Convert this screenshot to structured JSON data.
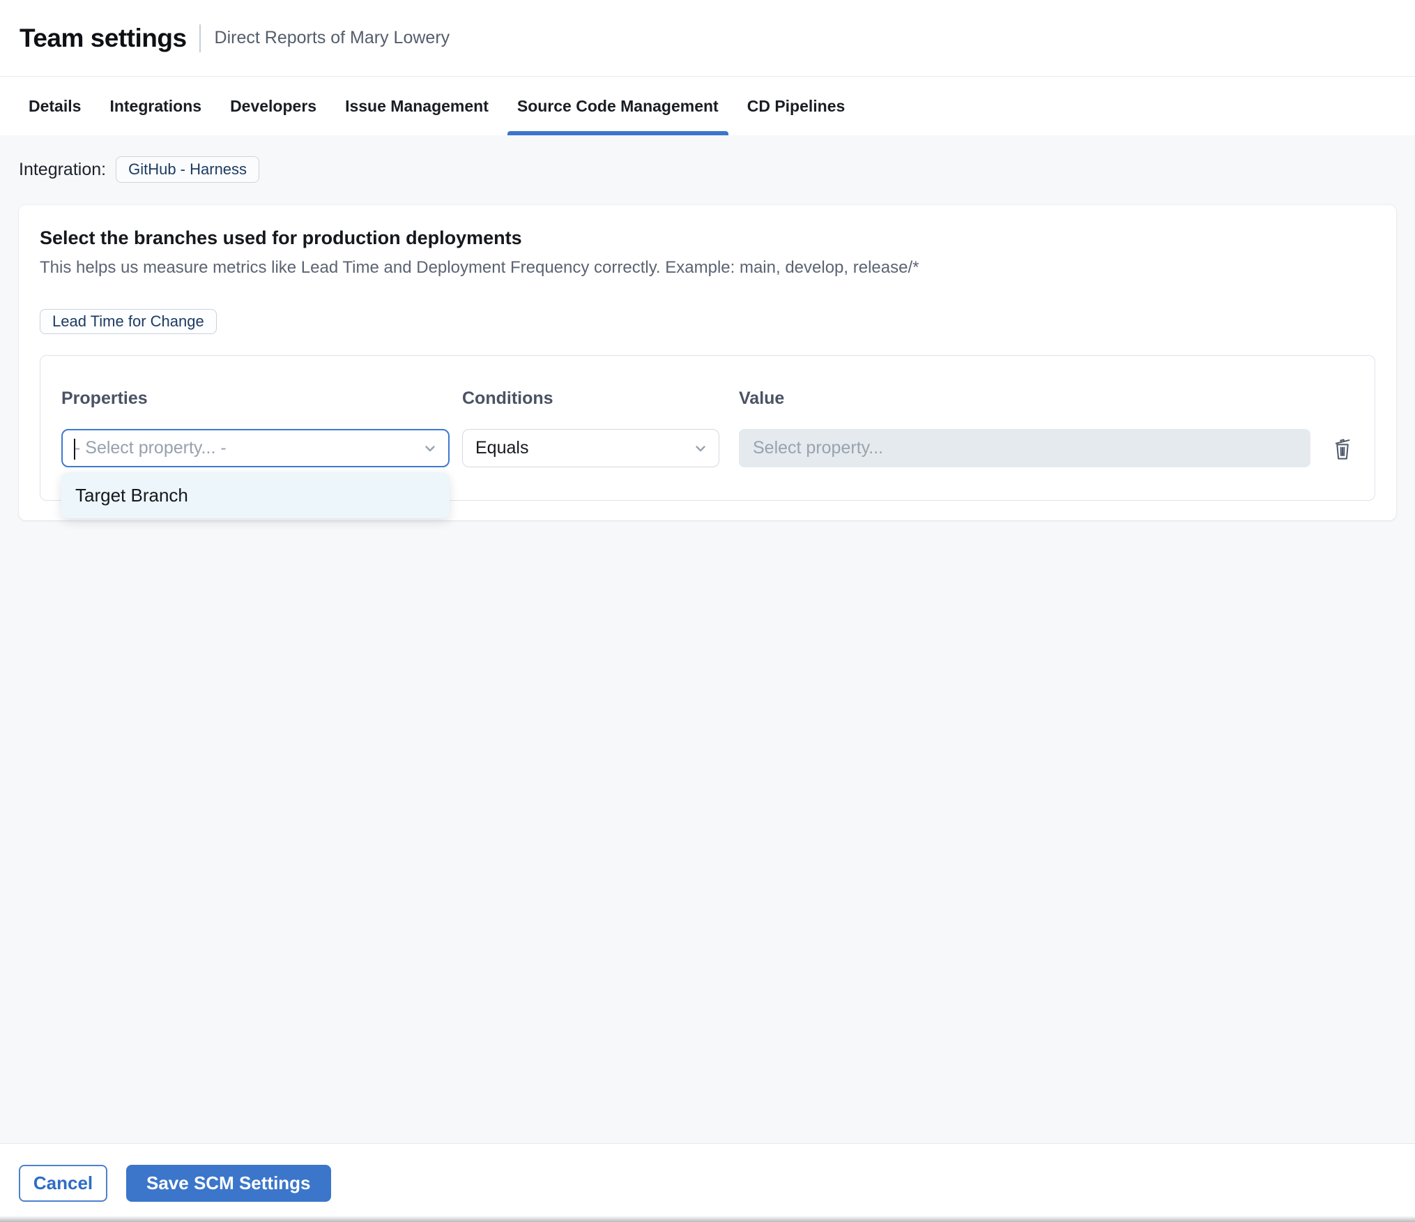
{
  "colors": {
    "accent_blue": "#3b76ca",
    "navy_chip_text": "#1d3b62",
    "page_background": "#f7f8fa",
    "disabled_field_background": "#e5eaee"
  },
  "header": {
    "title": "Team settings",
    "subtitle": "Direct Reports of Mary Lowery"
  },
  "tabs": [
    {
      "label": "Details",
      "active": false
    },
    {
      "label": "Integrations",
      "active": false
    },
    {
      "label": "Developers",
      "active": false
    },
    {
      "label": "Issue Management",
      "active": false
    },
    {
      "label": "Source Code Management",
      "active": true
    },
    {
      "label": "CD Pipelines",
      "active": false
    }
  ],
  "integration": {
    "label": "Integration:",
    "chip": "GitHub - Harness"
  },
  "branch_card": {
    "heading": "Select the branches used for production deployments",
    "description": "This helps us measure metrics like Lead Time and Deployment Frequency correctly. Example: main, develop, release/*",
    "metric_chip": "Lead Time for Change",
    "rule_builder": {
      "properties_label": "Properties",
      "conditions_label": "Conditions",
      "value_label": "Value",
      "property_placeholder": "- Select property... -",
      "condition_selected": "Equals",
      "value_placeholder": "Select property...",
      "property_options": [
        {
          "label": "Target Branch"
        }
      ]
    }
  },
  "footer": {
    "cancel": "Cancel",
    "save": "Save SCM Settings"
  }
}
